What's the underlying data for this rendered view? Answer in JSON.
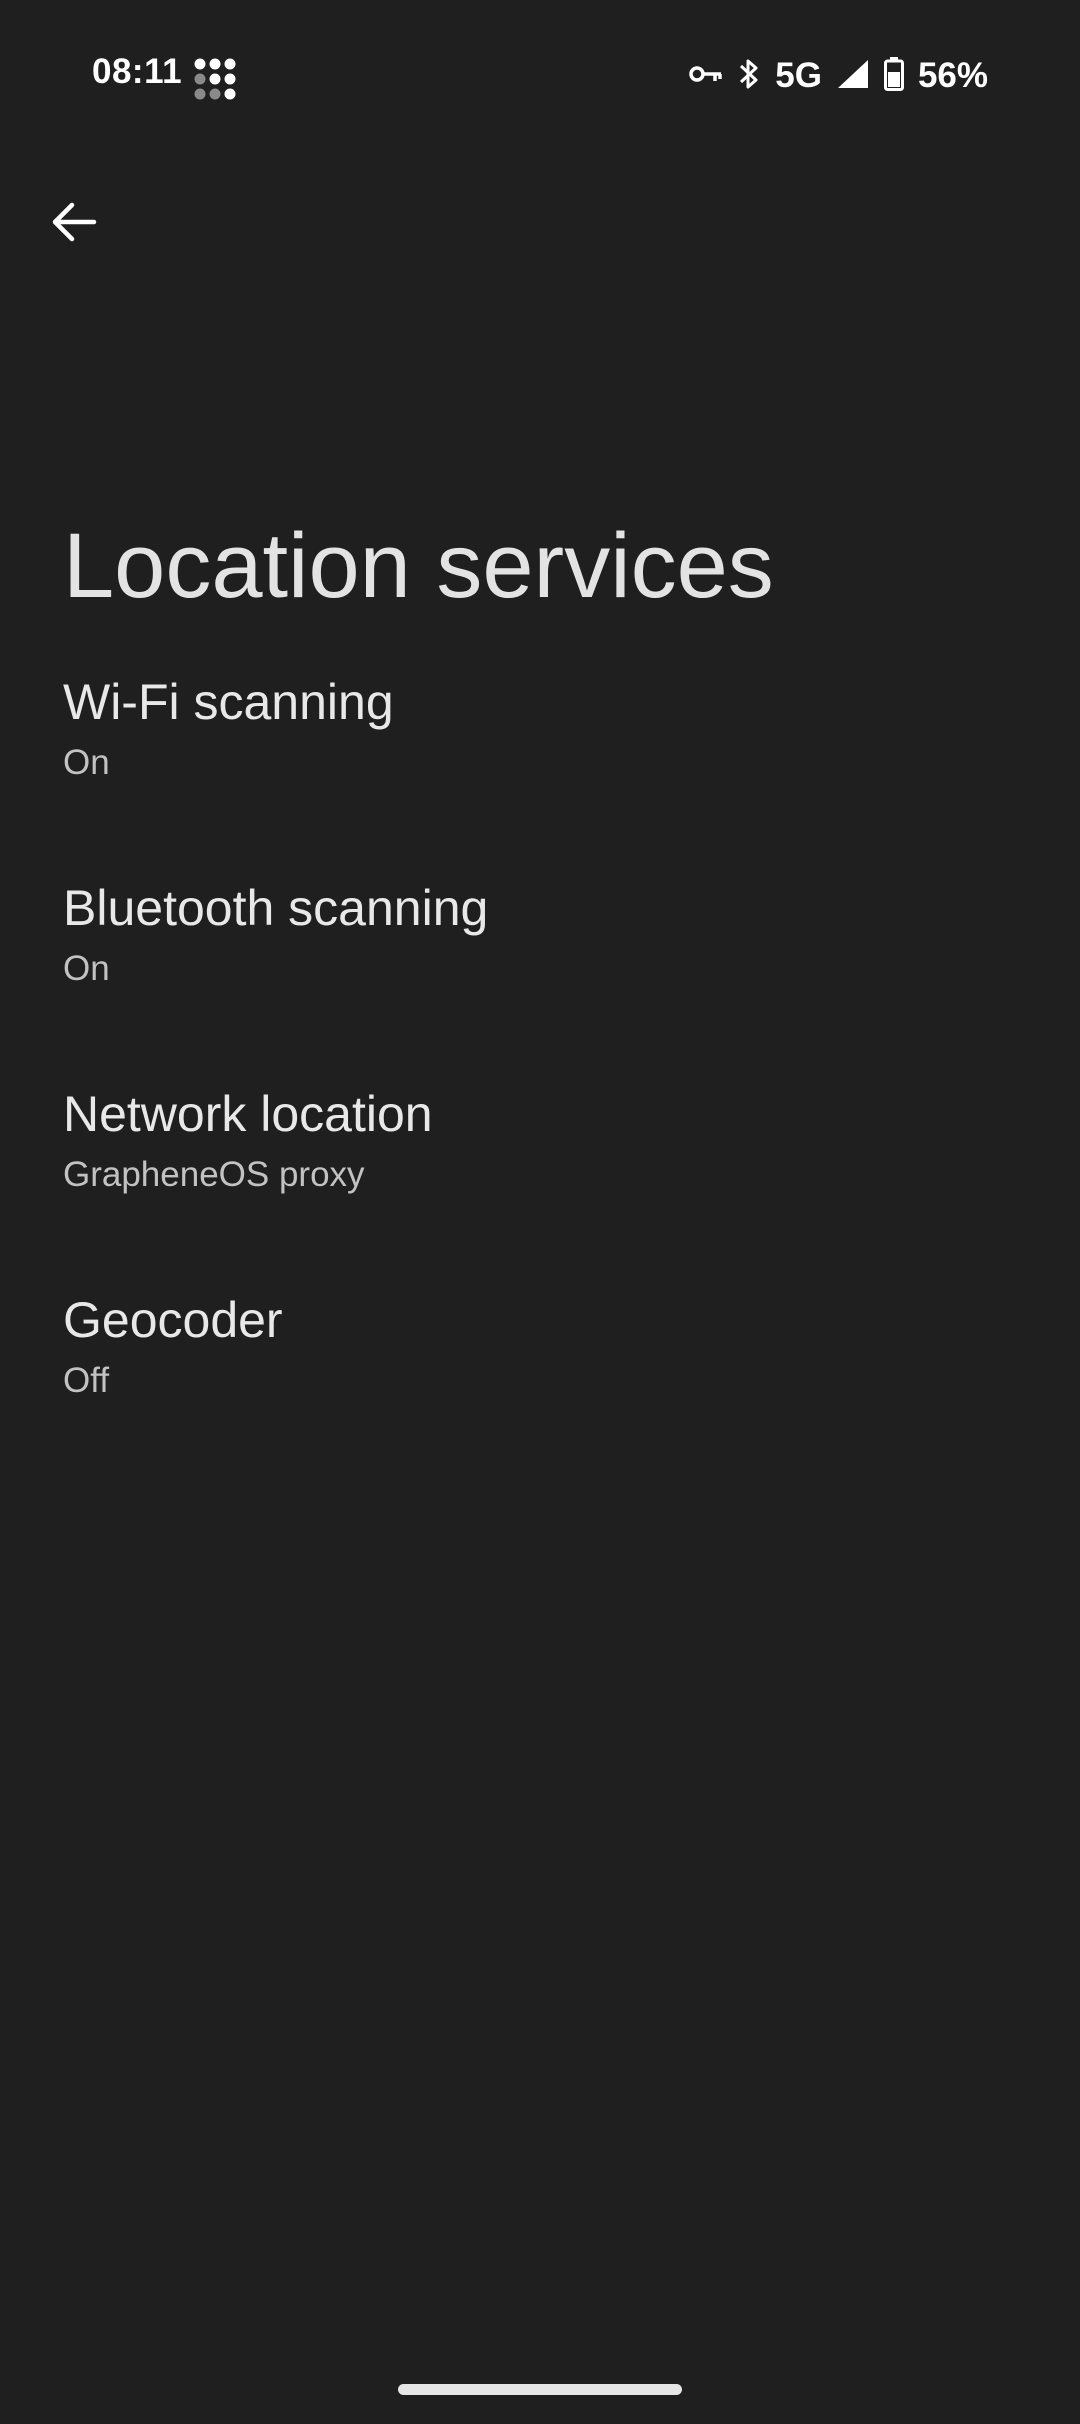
{
  "status_bar": {
    "time": "08:11",
    "network": "5G",
    "battery_percent": "56%",
    "icons": [
      "grid-dots-icon",
      "vpn-key-icon",
      "bluetooth-icon",
      "signal-icon",
      "battery-icon"
    ]
  },
  "header": {
    "back_icon": "arrow-back-icon",
    "title": "Location services"
  },
  "settings": {
    "items": [
      {
        "title": "Wi-Fi scanning",
        "summary": "On"
      },
      {
        "title": "Bluetooth scanning",
        "summary": "On"
      },
      {
        "title": "Network location",
        "summary": "GrapheneOS proxy"
      },
      {
        "title": "Geocoder",
        "summary": "Off"
      }
    ]
  },
  "colors": {
    "background": "#1f1f1f",
    "title_text": "#e3e3e3",
    "summary_text": "#c2c2c2"
  }
}
